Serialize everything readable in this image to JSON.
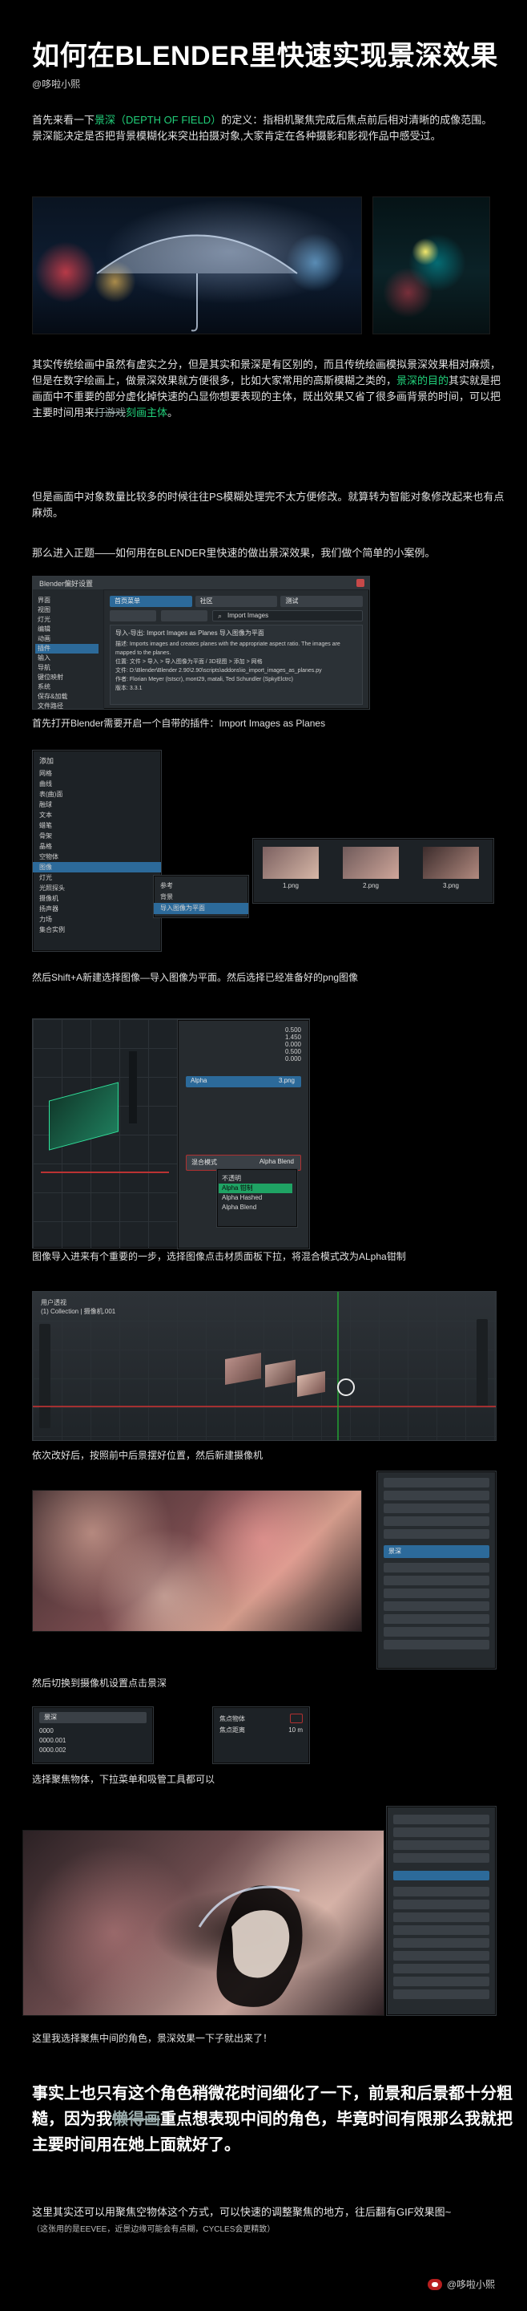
{
  "article": {
    "title": "如何在BLENDER里快速实现景深效果",
    "author": "@哆啦小熙"
  },
  "intro": {
    "line1_prefix": "首先来看一下",
    "line1_term": "景深（DEPTH OF FIELD）",
    "line1_suffix": "的定义：指相机聚焦完成后焦点前后相对清晰的成像范围。",
    "line2": "景深能决定是否把背景模糊化来突出拍摄对象,大家肯定在各种摄影和影视作品中感受过。"
  },
  "paragraphs": {
    "p1": "其实传统绘画中虽然有虚实之分，但是其实和景深是有区别的，而且传统绘画模拟景深效果相对麻烦，但是在数字绘画上，做景深效果就方便很多，比如大家常用的高斯模糊之类的，",
    "p1_green": "景深的目的",
    "p1_rest": "其实就是把画面中不重要的部分虚化掉快速的凸显你想要表现的主体，既出效果又省了很多画背景的时间，可以把主要时间用来",
    "p1_strike": "打游戏",
    "p1_green2": "刻画主体",
    "p1_end": "。",
    "p2": "但是画面中对象数量比较多的时候往往PS模糊处理完不太方便修改。就算转为智能对象修改起来也有点麻烦。",
    "p3": "那么进入正题——如何用在BLENDER里快速的做出景深效果，我们做个简单的小案例。"
  },
  "captions": {
    "c1": "首先打开Blender需要开启一个自带的插件：Import Images as Planes",
    "c2": "然后Shift+A新建选择图像—导入图像为平面。然后选择已经准备好的png图像",
    "c3": "图像导入进来有个重要的一步，选择图像点击材质面板下拉，将混合模式改为ALpha钳制",
    "c4": "依次改好后，按照前中后景摆好位置，然后新建摄像机",
    "c5": "然后切换到摄像机设置点击景深",
    "c6": "选择聚焦物体，下拉菜单和吸管工具都可以",
    "c7": "这里我选择聚焦中间的角色，景深效果一下子就出来了！"
  },
  "big_paragraph": {
    "text_a": "事实上也只有这个角色稍微花时间细化了一下，前景和后景都十分粗糙，因为我",
    "text_strike": "懒得画",
    "text_b": "重点想表现中间的角色，毕竟时间有限那么我就把主要时间用在她上面就好了。"
  },
  "footer": {
    "line1": "这里其实还可以用聚焦空物体这个方式，可以快速的调整聚焦的地方，往后翻有GIF效果图~",
    "line1_note": "（这张用的是EEVEE，近景边缘可能会有点糊，CYCLES会更精致）",
    "signature": "@哆啦小熙"
  },
  "screens": {
    "prefs": {
      "window_title": "Blender偏好设置",
      "tabs": [
        "首页菜单",
        "社区",
        "测试"
      ],
      "search_placeholder": "Import Images",
      "addon_label": "导入-导出: Import Images as Planes 导入图像为平面",
      "meta_desc_label": "描述:",
      "meta_desc_value": "Imports images and creates planes with the appropriate aspect ratio. The images are mapped to the planes.",
      "meta_loc_label": "位置:",
      "meta_loc_value": "文件 > 导入 > 导入图像为平面 / 3D视图 > 添加 > 网格",
      "meta_file_label": "文件:",
      "meta_file_value": "D:\\Blender\\Blender 2.90\\2.90\\scripts\\addons\\io_import_images_as_planes.py",
      "meta_author_label": "作者:",
      "meta_author_value": "Florian Meyer (tstscr), mont29, matali, Ted Schundler (SpkyElctrc)",
      "meta_version_label": "版本:",
      "meta_version_value": "3.3.1",
      "sidebar": [
        "界面",
        "视图",
        "灯光",
        "编辑",
        "动画",
        "插件",
        "输入",
        "导航",
        "键位映射",
        "系统",
        "保存&加载",
        "文件路径"
      ]
    },
    "add_menu": {
      "title": "添加",
      "items": [
        "网格",
        "曲线",
        "表(曲)面",
        "融球",
        "文本",
        "蜡笔",
        "骨架",
        "晶格",
        "空物体",
        "图像",
        "灯光",
        "光照探头",
        "摄像机",
        "扬声器",
        "力场",
        "集合实例"
      ],
      "submenu": [
        "参考",
        "背景",
        "导入图像为平面"
      ],
      "thumbs": [
        "1.png",
        "2.png",
        "3.png"
      ]
    },
    "material": {
      "alpha_label": "Alpha",
      "blend_mode_label": "混合模式",
      "blend_options": [
        "Alpha Blend",
        "不透明",
        "Alpha 钳制",
        "Alpha Hashed",
        "Alpha Blend"
      ],
      "image_name": "3.png",
      "values": [
        "0.500",
        "1.450",
        "0.000",
        "0.500",
        "0.000"
      ]
    },
    "viewport": {
      "header": "用户透视",
      "collection": "(1) Collection | 摄像机.001"
    },
    "camera": {
      "section": "景深",
      "focus_object_label": "焦点物体",
      "focus_distance_label": "焦点距离",
      "focus_distance_value": "10 m",
      "objects": [
        "0000",
        "0000.001",
        "0000.002"
      ]
    }
  },
  "colors": {
    "green": "#21d07a",
    "blender_panel": "#262b2f",
    "blender_blue": "#2c6a9a"
  }
}
